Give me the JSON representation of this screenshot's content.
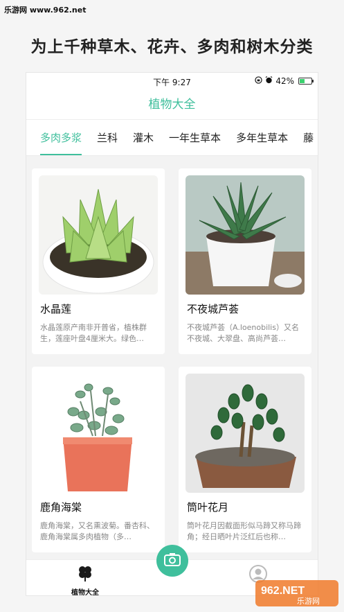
{
  "watermark": {
    "top_left": "乐游网 www.962.net",
    "bottom_right": "962.NET",
    "bottom_right_sub": "乐游网"
  },
  "headline": "为上千种草木、花卉、多肉和树木分类",
  "status_bar": {
    "time": "下午 9:27",
    "battery": "42%",
    "battery_level": 0.42
  },
  "app_title": "植物大全",
  "tabs": [
    {
      "label": "多肉多浆",
      "active": true
    },
    {
      "label": "兰科",
      "active": false
    },
    {
      "label": "灌木",
      "active": false
    },
    {
      "label": "一年生草本",
      "active": false
    },
    {
      "label": "多年生草本",
      "active": false
    },
    {
      "label": "藤",
      "active": false
    }
  ],
  "cards": [
    {
      "title": "水晶莲",
      "desc": "水晶莲原产南非开普省，植株群生，莲座叶盘4厘米大。绿色…"
    },
    {
      "title": "不夜城芦荟",
      "desc": "不夜城芦荟（A.loenobilis）又名不夜城、大翠盘、高尚芦荟…"
    },
    {
      "title": "鹿角海棠",
      "desc": "鹿角海棠，又名熏波菊。番杏科、鹿角海棠属多肉植物（多…"
    },
    {
      "title": "筒叶花月",
      "desc": "筒叶花月因截面形似马蹄又称马蹄角；经日晒叶片泛红后也称…"
    }
  ],
  "tabbar": {
    "home_label": "植物大全"
  },
  "colors": {
    "accent": "#3fbf9c"
  },
  "icons": [
    "camera-icon",
    "clover-icon",
    "profile-icon",
    "alarm-icon",
    "lock-rotation-icon"
  ]
}
